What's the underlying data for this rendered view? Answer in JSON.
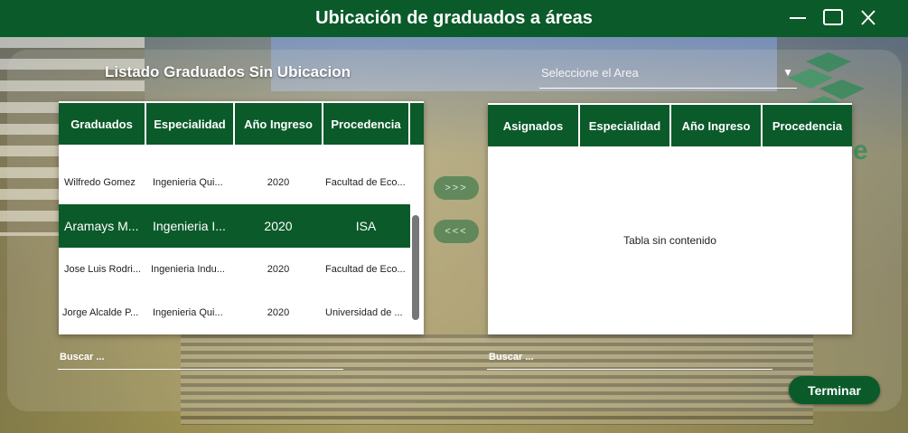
{
  "window": {
    "title": "Ubicación de graduados a áreas"
  },
  "left_panel": {
    "heading": "Listado Graduados Sin Ubicacion",
    "columns": [
      "Graduados",
      "Especialidad",
      "Año Ingreso",
      "Procedencia"
    ],
    "rows": [
      {
        "graduado": "Wilfredo Gomez",
        "especialidad": "Ingenieria Qui...",
        "anio": "2020",
        "procedencia": "Facultad de Eco..."
      },
      {
        "graduado": "Aramays M...",
        "especialidad": "Ingenieria I...",
        "anio": "2020",
        "procedencia": "ISA"
      },
      {
        "graduado": "Jose Luis Rodri...",
        "especialidad": "Ingenieria Indu...",
        "anio": "2020",
        "procedencia": "Facultad de Eco..."
      },
      {
        "graduado": "Jorge Alcalde P...",
        "especialidad": "Ingenieria Qui...",
        "anio": "2020",
        "procedencia": "Universidad de ..."
      }
    ],
    "selected_row": 1,
    "search_placeholder": "Buscar ..."
  },
  "right_panel": {
    "area_select_placeholder": "Seleccione el Area",
    "columns": [
      "Asignados",
      "Especialidad",
      "Año Ingreso",
      "Procedencia"
    ],
    "empty_message": "Tabla sin contenido",
    "search_placeholder": "Buscar ..."
  },
  "transfer": {
    "assign_label": ">>>",
    "unassign_label": "<<<"
  },
  "actions": {
    "finish_label": "Terminar"
  },
  "colors": {
    "primary_green": "#0b5a2a"
  }
}
